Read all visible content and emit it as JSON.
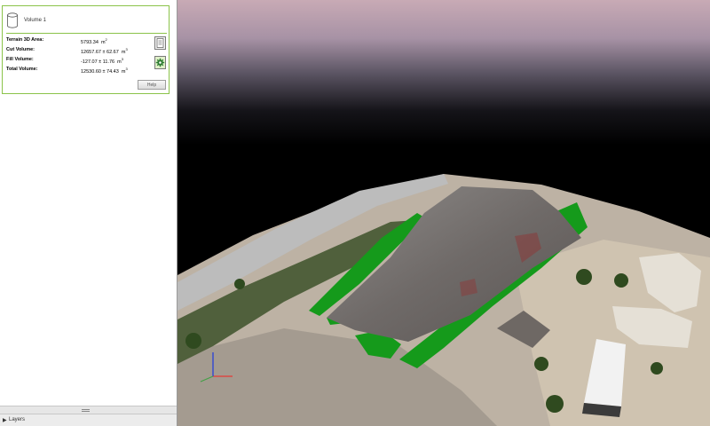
{
  "volume_panel": {
    "name": "Volume 1",
    "rows": [
      {
        "label": "Terrain 3D Area:",
        "value": "5793.34",
        "unit": "m",
        "sup": "2"
      },
      {
        "label": "Cut Volume:",
        "value": "12657.67  ± 62.67",
        "unit": "m",
        "sup": "3"
      },
      {
        "label": "Fill Volume:",
        "value": "-127.07  ± 11.76",
        "unit": "m",
        "sup": "3"
      },
      {
        "label": "Total Volume:",
        "value": "12530.60  ± 74.43",
        "unit": "m",
        "sup": "3"
      }
    ],
    "help_label": "Help",
    "icons": {
      "volume": "cylinder-icon",
      "report": "report-icon",
      "settings": "gear-icon"
    }
  },
  "layers": {
    "label": "Layers",
    "arrow": "▶"
  },
  "viewport": {
    "axes": {
      "x_color": "#e53935",
      "y_color": "#43a047",
      "z_color": "#1e3adf"
    },
    "colors": {
      "cut": "#9a9a9a",
      "fill": "#159a1b",
      "accent": "#8bc34a"
    }
  }
}
